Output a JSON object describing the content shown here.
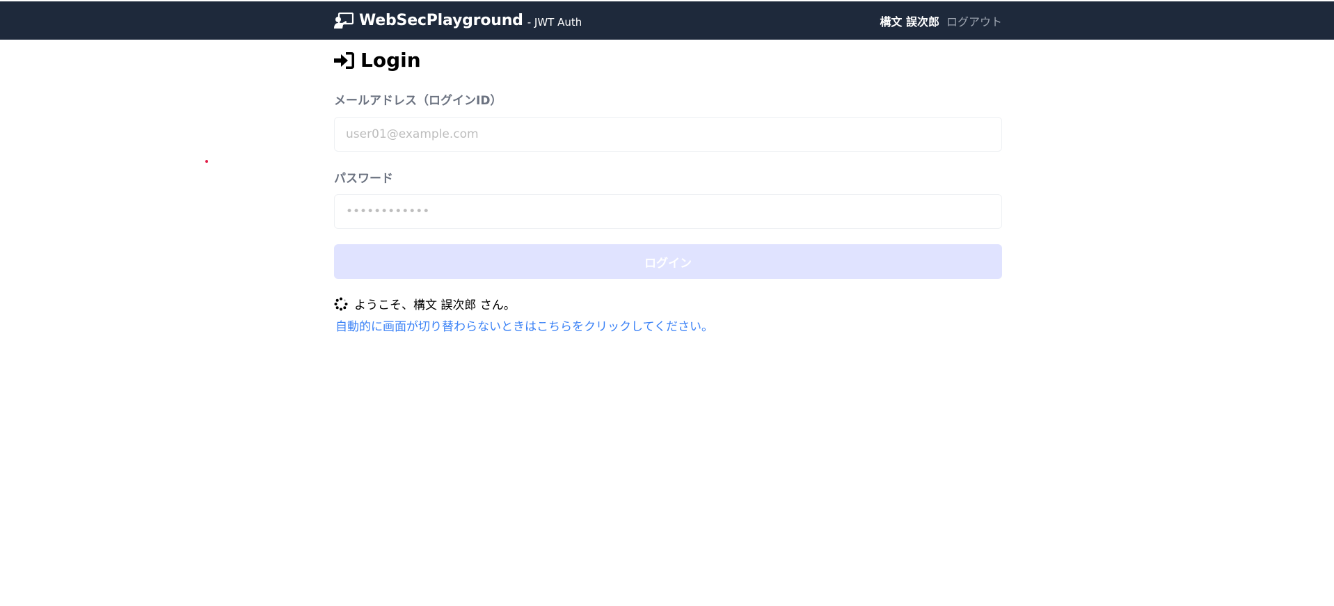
{
  "navbar": {
    "brand_name": "WebSecPlayground",
    "brand_sub": "- JWT Auth",
    "brand_icon": "user-presentation-icon",
    "user_name": "構文 誤次郎",
    "logout_label": "ログアウト"
  },
  "main": {
    "heading": "Login",
    "heading_icon": "sign-in-icon",
    "email": {
      "label": "メールアドレス（ログインID）",
      "placeholder": "user01@example.com",
      "value": ""
    },
    "password": {
      "label": "パスワード",
      "placeholder": "••••••••••••",
      "value": ""
    },
    "login_button_label": "ログイン",
    "status_icon": "spinner-icon",
    "status_text": "ようこそ、構文 誤次郎 さん。",
    "redirect_link_text": "自動的に画面が切り替わらないときはこちらをクリックしてください。"
  },
  "colors": {
    "navbar_bg": "#1e293b",
    "button_disabled_bg": "#e0e3ff",
    "link": "#3b82f6",
    "label": "#6b7280"
  }
}
